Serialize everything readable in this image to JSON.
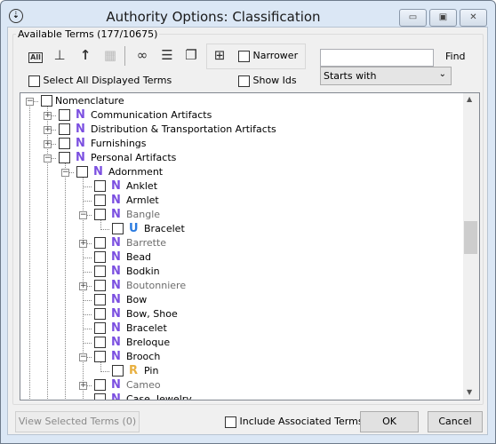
{
  "window": {
    "title": "Authority Options: Classification",
    "minimize": "▭",
    "maximize": "▣",
    "close": "✕",
    "sys_icon": "⇣"
  },
  "group": {
    "label": "Available Terms (177/10675)"
  },
  "toolbar": {
    "icons": [
      "all-icon",
      "hierarchy-icon",
      "up-arrow-icon",
      "grid-icon",
      "binoculars-icon",
      "list-icon",
      "copy-icon",
      "add-icon"
    ],
    "all_label": "All",
    "narrower": "Narrower",
    "select_all": "Select All Displayed Terms",
    "show_ids": "Show Ids"
  },
  "find": {
    "value": "",
    "button": "Find",
    "mode": "Starts with"
  },
  "badge_colors": {
    "N": "#7b4fe0",
    "U": "#2b7be0",
    "R": "#e8b040"
  },
  "tree": [
    {
      "level": 0,
      "label": "Nomenclature",
      "exp": "-",
      "badge": ""
    },
    {
      "level": 1,
      "label": "Communication Artifacts",
      "exp": "+",
      "badge": "N"
    },
    {
      "level": 1,
      "label": "Distribution & Transportation Artifacts",
      "exp": "+",
      "badge": "N"
    },
    {
      "level": 1,
      "label": "Furnishings",
      "exp": "+",
      "badge": "N"
    },
    {
      "level": 1,
      "label": "Personal Artifacts",
      "exp": "-",
      "badge": "N"
    },
    {
      "level": 2,
      "label": "Adornment",
      "exp": "-",
      "badge": "N"
    },
    {
      "level": 3,
      "label": "Anklet",
      "exp": "",
      "badge": "N"
    },
    {
      "level": 3,
      "label": "Armlet",
      "exp": "",
      "badge": "N"
    },
    {
      "level": 3,
      "label": "Bangle",
      "exp": "-",
      "badge": "N",
      "dim": true
    },
    {
      "level": 4,
      "label": "Bracelet",
      "exp": "",
      "badge": "U"
    },
    {
      "level": 3,
      "label": "Barrette",
      "exp": "+",
      "badge": "N",
      "dim": true
    },
    {
      "level": 3,
      "label": "Bead",
      "exp": "",
      "badge": "N"
    },
    {
      "level": 3,
      "label": "Bodkin",
      "exp": "",
      "badge": "N"
    },
    {
      "level": 3,
      "label": "Boutonniere",
      "exp": "+",
      "badge": "N",
      "dim": true
    },
    {
      "level": 3,
      "label": "Bow",
      "exp": "",
      "badge": "N"
    },
    {
      "level": 3,
      "label": "Bow, Shoe",
      "exp": "",
      "badge": "N"
    },
    {
      "level": 3,
      "label": "Bracelet",
      "exp": "",
      "badge": "N"
    },
    {
      "level": 3,
      "label": "Breloque",
      "exp": "",
      "badge": "N"
    },
    {
      "level": 3,
      "label": "Brooch",
      "exp": "-",
      "badge": "N"
    },
    {
      "level": 4,
      "label": "Pin",
      "exp": "",
      "badge": "R"
    },
    {
      "level": 3,
      "label": "Cameo",
      "exp": "+",
      "badge": "N",
      "dim": true
    },
    {
      "level": 3,
      "label": "Case, Jewelry",
      "exp": "",
      "badge": "N"
    }
  ],
  "footer": {
    "view_selected": "View Selected Terms (0)",
    "include_assoc": "Include Associated Terms",
    "ok": "OK",
    "cancel": "Cancel"
  }
}
